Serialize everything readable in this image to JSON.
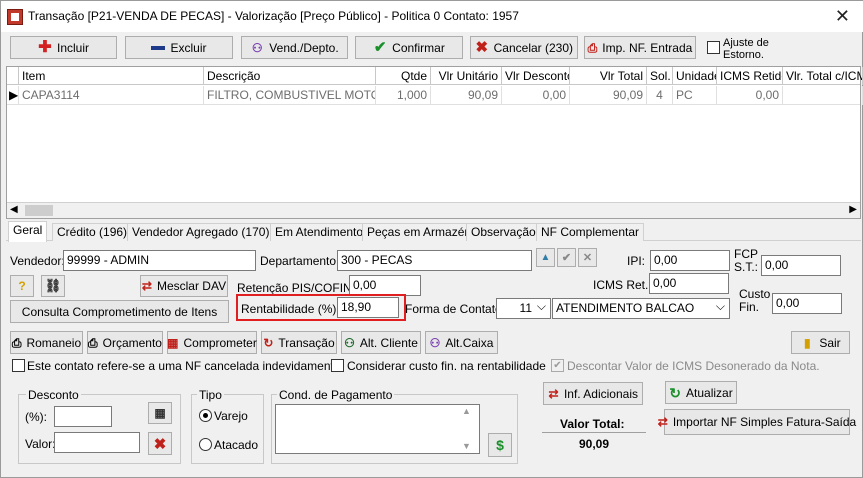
{
  "window": {
    "title": "Transação [P21-VENDA DE PECAS] - Valorização [Preço Público] - Politica 0  Contato: 1957",
    "close": "✕"
  },
  "toolbar": {
    "incluir": "Incluir",
    "excluir": "Excluir",
    "vend_depto": "Vend./Depto.",
    "confirmar": "Confirmar",
    "cancelar": "Cancelar (230)",
    "imp_nf": "Imp. NF. Entrada",
    "ajuste": "Ajuste de Estorno."
  },
  "grid": {
    "headers": [
      "Item",
      "Descrição",
      "Qtde",
      "Vlr Unitário",
      "Vlr Desconto",
      "Vlr Total",
      "Sol.",
      "Unidade",
      "ICMS Retido",
      "Vlr. Total c/ICMS"
    ],
    "row": [
      "CAPA3114",
      "FILTRO, COMBUSTIVEL MOTOR - 4",
      "1,000",
      "90,09",
      "0,00",
      "90,09",
      "4",
      "PC",
      "0,00",
      ""
    ]
  },
  "tabs": [
    "Geral",
    "Crédito (196)",
    "Vendedor Agregado (170)",
    "Em Atendimento",
    "Peças em Armazém",
    "Observação",
    "NF Complementar"
  ],
  "geral": {
    "vendedor_label": "Vendedor:",
    "vendedor_value": "99999 - ADMIN",
    "departamento_label": "Departamento:",
    "departamento_value": "300 - PECAS",
    "ipi_label": "IPI:",
    "ipi_value": "0,00",
    "fcp_label": "FCP S.T.:",
    "fcp_value": "0,00",
    "mesclar": "Mesclar DAV",
    "retencao_label": "Retenção PIS/COFINS:",
    "retencao_value": "0,00",
    "icms_ret_label": "ICMS Ret.:",
    "icms_ret_value": "0,00",
    "consulta": "Consulta Comprometimento de Itens",
    "rentab_label": "Rentabilidade (%):",
    "rentab_value": "18,90",
    "forma_label": "Forma de Contato:",
    "forma_num": "11",
    "forma_value": "ATENDIMENTO BALCAO",
    "custo_label": "Custo Fin.",
    "custo_value": "0,00",
    "romaneio": "Romaneio",
    "orcamento": "Orçamento",
    "comprometer": "Comprometer",
    "transacao": "Transação",
    "alt_cliente": "Alt. Cliente",
    "alt_caixa": "Alt.Caixa",
    "sair": "Sair",
    "chk_cancelada": "Este contato refere-se a uma NF cancelada indevidamente",
    "chk_custo": "Considerar custo fin. na rentabilidade",
    "chk_icms": "Descontar Valor de ICMS Desonerado da Nota.",
    "desconto_title": "Desconto",
    "desc_pct_label": "(%):",
    "desc_valor_label": "Valor:",
    "tipo_title": "Tipo",
    "varejo": "Varejo",
    "atacado": "Atacado",
    "cond_title": "Cond. de Pagamento",
    "inf_adic": "Inf. Adicionais",
    "atualizar": "Atualizar",
    "valor_total_label": "Valor Total:",
    "valor_total": "90,09",
    "importar": "Importar NF Simples Fatura-Saída"
  }
}
